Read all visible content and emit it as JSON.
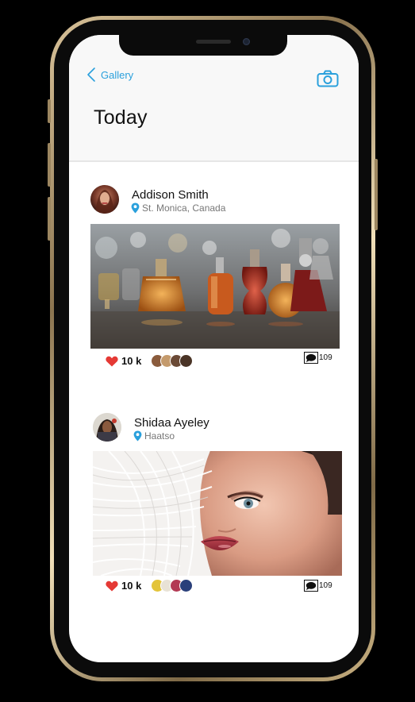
{
  "nav": {
    "back_label": "Gallery"
  },
  "page": {
    "title": "Today"
  },
  "posts": [
    {
      "name": "Addison Smith",
      "location": "St. Monica, Canada",
      "likes": "10 k",
      "comments": "109"
    },
    {
      "name": "Shidaa Ayeley",
      "location": "Haatso",
      "likes": "10 k",
      "comments": "109"
    }
  ],
  "colors": {
    "accent": "#2aa0dc",
    "heart": "#e53935"
  }
}
